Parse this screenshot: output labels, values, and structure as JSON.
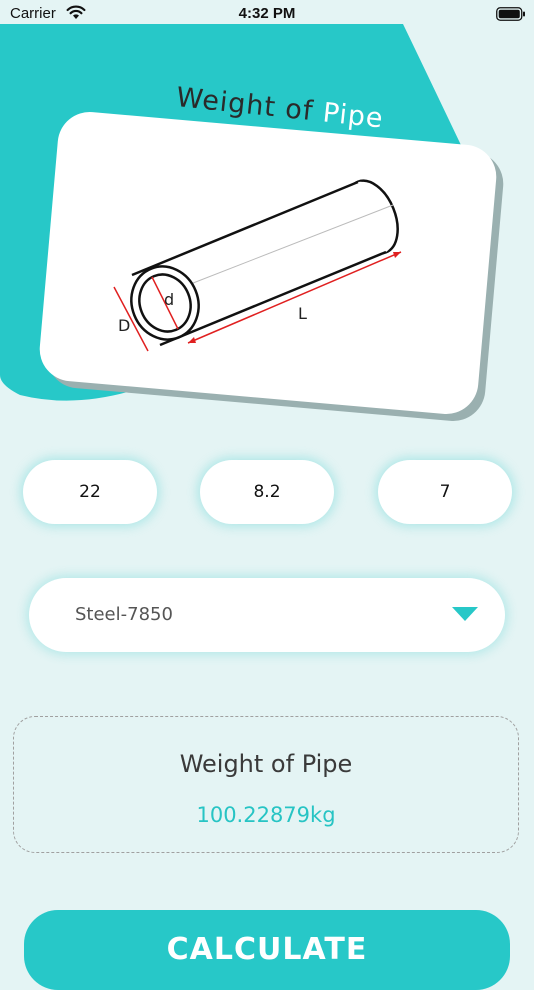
{
  "status_bar": {
    "carrier": "Carrier",
    "time": "4:32 PM"
  },
  "hero": {
    "title_prefix": "Weight of",
    "title_accent": "Pipe",
    "label_outer_diameter": "D",
    "label_inner_diameter": "d",
    "label_length": "L"
  },
  "inputs": {
    "field_1": "22",
    "field_2": "8.2",
    "field_3": "7"
  },
  "material": {
    "selected": "Steel-7850"
  },
  "result": {
    "label": "Weight of Pipe",
    "value": "100.22879kg"
  },
  "actions": {
    "calculate_label": "CALCULATE"
  },
  "colors": {
    "accent": "#27c8c8",
    "background": "#e4f4f4",
    "dimension_line": "#e02020"
  }
}
